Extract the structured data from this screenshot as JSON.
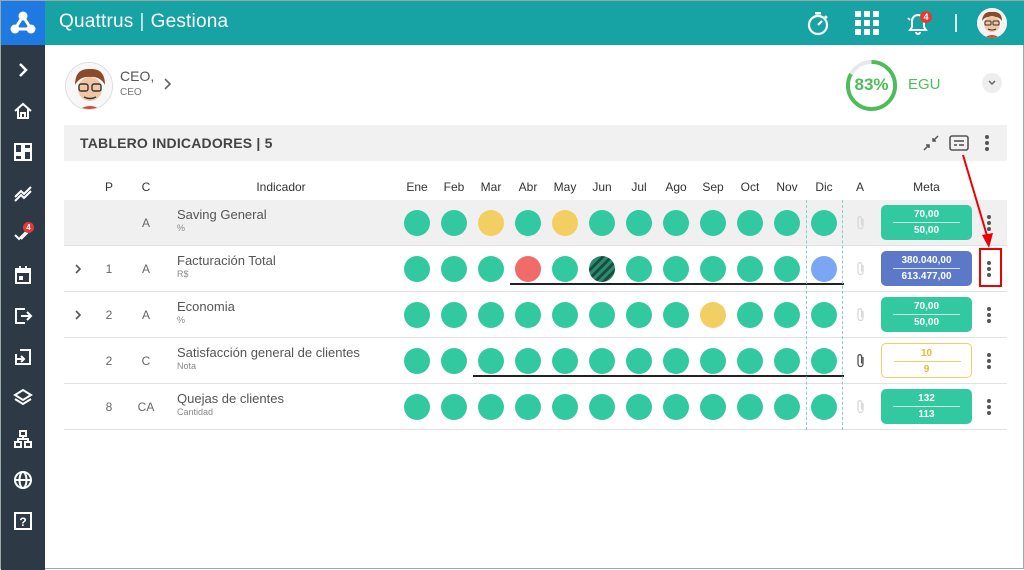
{
  "app": {
    "brand_name": "Quattrus",
    "brand_module": "Gestiona"
  },
  "topbar": {
    "notification_count": "4",
    "icons": [
      "timer-icon",
      "apps-grid-icon",
      "bell-icon",
      "user-avatar"
    ]
  },
  "sidebar": {
    "items": [
      {
        "icon": "chevron-right-icon"
      },
      {
        "icon": "home-icon"
      },
      {
        "icon": "dashboard-icon"
      },
      {
        "icon": "trend-icon"
      },
      {
        "icon": "tasks-icon",
        "badge": "4"
      },
      {
        "icon": "calendar-icon"
      },
      {
        "icon": "logout-icon"
      },
      {
        "icon": "export-icon"
      },
      {
        "icon": "layers-icon"
      },
      {
        "icon": "hierarchy-icon"
      },
      {
        "icon": "globe-icon"
      },
      {
        "icon": "help-icon"
      }
    ]
  },
  "user": {
    "role": "CEO,",
    "sub": "CEO"
  },
  "egu": {
    "percent": "83%",
    "label": "EGU",
    "value": 0.83,
    "color": "#4dbd5a"
  },
  "panel": {
    "title": "TABLERO INDICADORES | 5"
  },
  "table": {
    "headers": {
      "p": "P",
      "c": "C",
      "indicator": "Indicador",
      "a": "A",
      "meta": "Meta"
    },
    "months": [
      "Ene",
      "Feb",
      "Mar",
      "Abr",
      "May",
      "Jun",
      "Jul",
      "Ago",
      "Sep",
      "Oct",
      "Nov",
      "Dic"
    ],
    "rows": [
      {
        "p": "",
        "c": "A",
        "name": "Saving General",
        "unit": "%",
        "expandable": false,
        "selected": true,
        "status": [
          "green",
          "green",
          "yellow",
          "green",
          "yellow",
          "green",
          "green",
          "green",
          "green",
          "green",
          "green",
          "green"
        ],
        "clip": false,
        "meta_top": "70,00",
        "meta_bottom": "50,00",
        "meta_style": "green"
      },
      {
        "p": "1",
        "c": "A",
        "name": "Facturación Total",
        "unit": "R$",
        "expandable": true,
        "selected": false,
        "status": [
          "green",
          "green",
          "green",
          "red",
          "green",
          "hatched",
          "green",
          "green",
          "green",
          "green",
          "green",
          "blue"
        ],
        "clip": false,
        "meta_top": "380.040,00",
        "meta_bottom": "613.477,00",
        "meta_style": "blue"
      },
      {
        "p": "2",
        "c": "A",
        "name": "Economia",
        "unit": "%",
        "expandable": true,
        "selected": false,
        "status": [
          "green",
          "green",
          "green",
          "green",
          "green",
          "green",
          "green",
          "green",
          "yellow",
          "green",
          "green",
          "green"
        ],
        "clip": false,
        "meta_top": "70,00",
        "meta_bottom": "50,00",
        "meta_style": "green"
      },
      {
        "p": "2",
        "c": "C",
        "name": "Satisfacción general de clientes",
        "unit": "Nota",
        "expandable": false,
        "selected": false,
        "status": [
          "green",
          "green",
          "green",
          "green",
          "green",
          "green",
          "green",
          "green",
          "green",
          "green",
          "green",
          "green"
        ],
        "clip": true,
        "meta_top": "10",
        "meta_bottom": "9",
        "meta_style": "outline"
      },
      {
        "p": "8",
        "c": "CA",
        "name": "Quejas de clientes",
        "unit": "Cantidad",
        "expandable": false,
        "selected": false,
        "status": [
          "green",
          "green",
          "green",
          "green",
          "green",
          "green",
          "green",
          "green",
          "green",
          "green",
          "green",
          "green"
        ],
        "clip": false,
        "meta_top": "132",
        "meta_bottom": "113",
        "meta_style": "green"
      }
    ]
  },
  "colors": {
    "green": "#33c9a0",
    "yellow": "#f2cf63",
    "red": "#f26b6b",
    "blue": "#7aa6f2",
    "teal_bar": "#17a3a3",
    "sidebar": "#2d3a46",
    "meta_blue": "#5c78c8"
  }
}
